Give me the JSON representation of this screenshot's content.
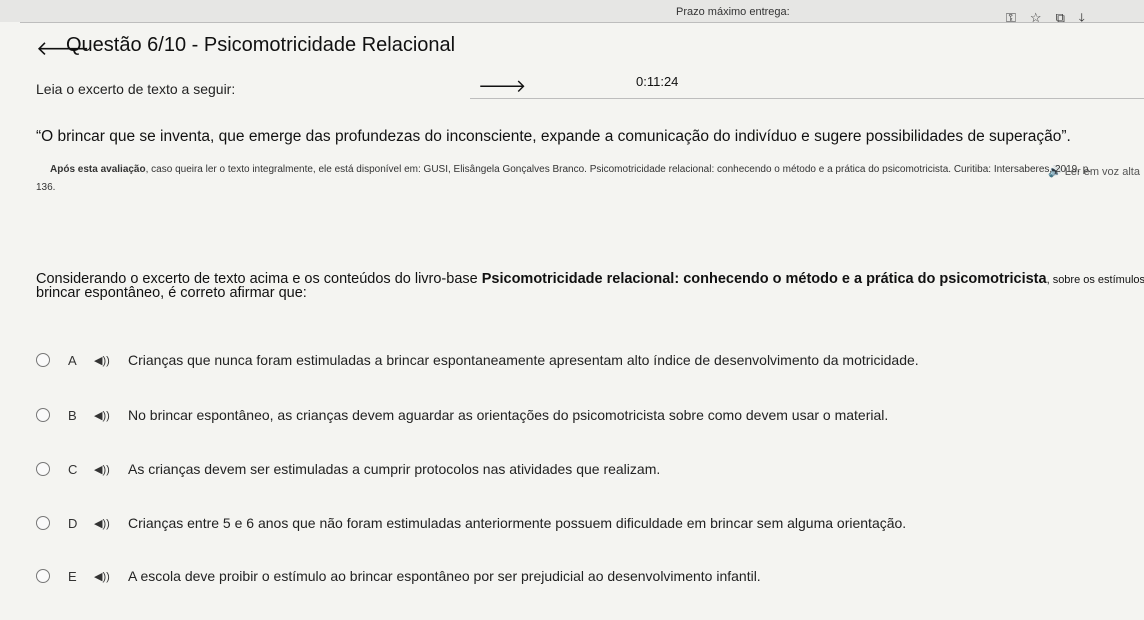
{
  "browser": {
    "deadline_label": "Prazo máximo entrega:",
    "icons": [
      "key-icon",
      "star-icon",
      "extension-icon",
      "download-icon"
    ]
  },
  "header": {
    "title": "Questão 6/10 - Psicomotricidade Relacional",
    "timer": "0:11:24"
  },
  "content": {
    "lead": "Leia o excerto de texto a seguir:",
    "quote": "“O brincar que se inventa, que emerge das profundezas do inconsciente, expande a comunicação do indivíduo e sugere possibilidades de superação”.",
    "tts_label": "🔊 Ler em voz alta",
    "note_bold": "Após esta avaliação",
    "note_rest": ", caso queira ler o texto integralmente, ele está disponível em: GUSI, Elisângela Gonçalves Branco. Psicomotricidade relacional: conhecendo o método e a prática do psicomotricista. Curitiba: Intersaberes, 2019. p.",
    "page_number": "136.",
    "stem_prefix": "Considerando o excerto de texto acima e os conteúdos do livro-base ",
    "stem_bold": "Psicomotricidade relacional: conhecendo o método e a prática do psicomotricista",
    "stem_suffix": ", sobre os estímulos do",
    "stem_line2": "brincar espontâneo, é correto afirmar que:"
  },
  "options": [
    {
      "letter": "A",
      "text": "Crianças que nunca foram estimuladas a brincar espontaneamente apresentam alto índice de desenvolvimento da motricidade."
    },
    {
      "letter": "B",
      "text": "No brincar espontâneo, as crianças devem aguardar as orientações do psicomotricista sobre como devem usar o material."
    },
    {
      "letter": "C",
      "text": "As crianças devem ser estimuladas a cumprir protocolos nas atividades que realizam."
    },
    {
      "letter": "D",
      "text": "Crianças entre 5 e 6 anos que não foram estimuladas anteriormente possuem dificuldade em brincar sem alguma orientação."
    },
    {
      "letter": "E",
      "text": "A escola deve proibir o estímulo ao brincar espontâneo por ser prejudicial ao desenvolvimento infantil."
    }
  ],
  "speaker_glyph": "◀))"
}
